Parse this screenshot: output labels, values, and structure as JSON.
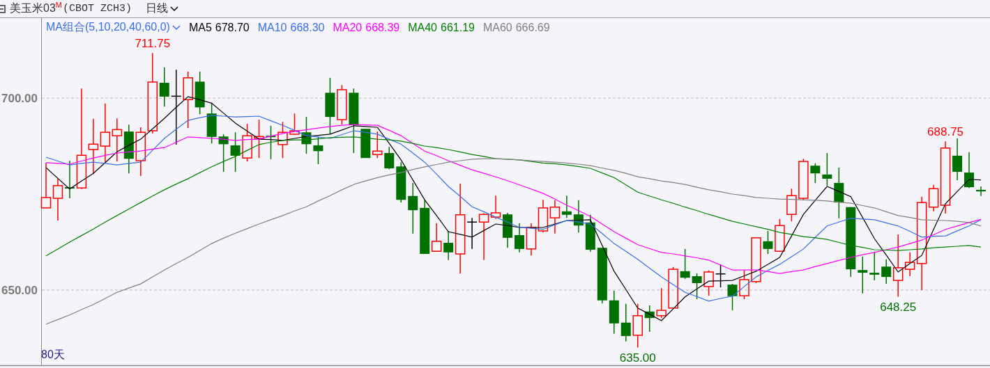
{
  "header": {
    "symbol": "美玉米03$^{M}$",
    "code": "(CBOT ZCH3)",
    "period": "日线"
  },
  "chart": {
    "ma_group": "MA组合(5,10,20,40,60,0)",
    "ma_values": [
      "678.70",
      "668.30",
      "668.39",
      "661.19",
      "666.69"
    ],
    "range_label": "80天",
    "chart_data": {
      "type": "candlestick",
      "ylim": [
        630.4,
        720.5
      ],
      "ohlc": [
        [
          671.4,
          683.1,
          671.4,
          674.1
        ],
        [
          673.9,
          679.0,
          668.1,
          677.2
        ],
        [
          676.8,
          683.7,
          673.9,
          676.6
        ],
        [
          676.6,
          702.5,
          676.3,
          685.1
        ],
        [
          686.6,
          694.6,
          680.2,
          688.0
        ],
        [
          687.5,
          698.6,
          683.3,
          691.1
        ],
        [
          690.2,
          694.7,
          683.5,
          691.8
        ],
        [
          691.3,
          693.1,
          680.4,
          684.2
        ],
        [
          683.7,
          692.4,
          679.7,
          691.1
        ],
        [
          691.5,
          711.75,
          690.8,
          704.2
        ],
        [
          704.0,
          708.0,
          697.8,
          700.4
        ],
        [
          700.5,
          707.4,
          687.9,
          700.5
        ],
        [
          699.6,
          706.9,
          692.2,
          705.3
        ],
        [
          704.3,
          706.9,
          695.8,
          697.6
        ],
        [
          696.0,
          698.7,
          688.2,
          689.9
        ],
        [
          690.0,
          690.6,
          680.8,
          688.0
        ],
        [
          687.7,
          691.1,
          680.8,
          685.0
        ],
        [
          684.4,
          693.3,
          683.5,
          690.2
        ],
        [
          689.5,
          694.4,
          684.4,
          690.0
        ],
        [
          690.2,
          692.8,
          684.1,
          689.9
        ],
        [
          687.9,
          693.8,
          684.4,
          691.1
        ],
        [
          690.6,
          696.0,
          690.6,
          691.5
        ],
        [
          691.1,
          695.1,
          685.5,
          688.0
        ],
        [
          687.7,
          689.9,
          682.8,
          686.2
        ],
        [
          701.4,
          705.3,
          690.6,
          695.1
        ],
        [
          694.4,
          703.4,
          693.1,
          702.2
        ],
        [
          701.4,
          702.5,
          685.7,
          693.1
        ],
        [
          692.0,
          692.0,
          684.4,
          684.4
        ],
        [
          685.3,
          691.3,
          684.4,
          686.2
        ],
        [
          685.7,
          687.3,
          681.5,
          681.7
        ],
        [
          682.2,
          683.3,
          672.8,
          673.5
        ],
        [
          674.5,
          677.9,
          664.7,
          670.8
        ],
        [
          671.4,
          673.5,
          659.4,
          659.4
        ],
        [
          660.1,
          667.4,
          660.0,
          662.7
        ],
        [
          662.3,
          665.4,
          657.8,
          659.8
        ],
        [
          659.4,
          677.7,
          654.3,
          669.6
        ],
        [
          667.7,
          668.8,
          660.7,
          667.7
        ],
        [
          667.7,
          670.0,
          657.8,
          669.7
        ],
        [
          669.0,
          674.6,
          668.5,
          670.1
        ],
        [
          669.7,
          670.1,
          661.0,
          663.6
        ],
        [
          664.3,
          667.4,
          659.8,
          660.7
        ],
        [
          660.7,
          667.4,
          659.0,
          666.3
        ],
        [
          665.4,
          673.5,
          665.0,
          671.4
        ],
        [
          668.8,
          673.4,
          664.7,
          671.6
        ],
        [
          670.5,
          674.6,
          668.8,
          669.6
        ],
        [
          669.7,
          673.4,
          665.0,
          666.8
        ],
        [
          667.6,
          669.6,
          660.0,
          660.5
        ],
        [
          661.0,
          661.0,
          646.5,
          647.3
        ],
        [
          647.3,
          649.8,
          638.6,
          641.3
        ],
        [
          641.5,
          646.4,
          636.6,
          638.0
        ],
        [
          638.2,
          646.4,
          635.0,
          643.3
        ],
        [
          644.4,
          646.0,
          639.1,
          642.7
        ],
        [
          643.3,
          650.5,
          642.7,
          644.7
        ],
        [
          645.3,
          656.0,
          645.3,
          655.4
        ],
        [
          654.9,
          660.7,
          652.9,
          653.2
        ],
        [
          653.6,
          654.3,
          647.6,
          651.8
        ],
        [
          650.9,
          655.1,
          648.5,
          654.7
        ],
        [
          654.2,
          656.7,
          650.7,
          654.2
        ],
        [
          651.4,
          651.6,
          644.7,
          648.4
        ],
        [
          648.5,
          655.1,
          647.6,
          652.7
        ],
        [
          652.2,
          663.6,
          651.8,
          663.6
        ],
        [
          662.7,
          665.4,
          659.4,
          660.7
        ],
        [
          660.1,
          668.5,
          660.0,
          666.8
        ],
        [
          669.7,
          676.4,
          667.9,
          674.6
        ],
        [
          673.9,
          684.2,
          673.4,
          683.5
        ],
        [
          682.4,
          683.0,
          677.9,
          680.4
        ],
        [
          680.1,
          685.7,
          677.2,
          679.0
        ],
        [
          677.9,
          681.9,
          668.7,
          672.8
        ],
        [
          671.6,
          671.6,
          653.4,
          655.4
        ],
        [
          655.2,
          658.7,
          649.1,
          654.5
        ],
        [
          654.5,
          660.0,
          652.5,
          654.0
        ],
        [
          656.1,
          658.0,
          651.6,
          653.4
        ],
        [
          652.5,
          664.5,
          648.25,
          655.8
        ],
        [
          655.4,
          659.8,
          653.6,
          657.2
        ],
        [
          656.9,
          674.3,
          650.0,
          672.8
        ],
        [
          671.6,
          677.4,
          670.5,
          676.4
        ],
        [
          672.1,
          688.75,
          669.9,
          687.0
        ],
        [
          685.0,
          689.5,
          678.6,
          680.8
        ],
        [
          680.6,
          685.9,
          676.6,
          676.8
        ],
        [
          676.1,
          677.0,
          674.5,
          675.7
        ]
      ],
      "annotations": [
        "711.75",
        "635.00",
        "648.25",
        "688.75"
      ]
    },
    "moving_averages": {
      "chart_data": {
        "type": "line",
        "ylim": [
          630.4,
          720.5
        ],
        "yticks": [
          {
            "value": 700,
            "label": "700.00"
          },
          {
            "value": 650,
            "label": "650.00"
          }
        ],
        "series": [
          {
            "name": "MA5",
            "color": "#000000",
            "values": [
              681.9,
              679.1,
              676.3,
              678.4,
              680.4,
              683.2,
              686.0,
              687.7,
              689.3,
              692.0,
              694.7,
              697.6,
              700.4,
              699.6,
              698.7,
              696.1,
              693.5,
              691.4,
              689.3,
              689.2,
              689.0,
              689.5,
              690.0,
              690.3,
              690.6,
              691.7,
              692.8,
              692.6,
              692.4,
              688.2,
              683.9,
              678.7,
              673.5,
              669.4,
              665.2,
              664.5,
              663.8,
              665.5,
              667.2,
              666.8,
              666.3,
              666.3,
              666.3,
              667.2,
              668.1,
              668.2,
              668.3,
              661.6,
              654.9,
              650.1,
              645.3,
              643.7,
              642.0,
              645.1,
              648.2,
              650.3,
              652.3,
              652.4,
              652.5,
              653.7,
              654.9,
              656.7,
              658.5,
              664.1,
              669.7,
              673.4,
              677.0,
              675.7,
              674.3,
              668.9,
              663.4,
              659.1,
              654.7,
              656.9,
              659.0,
              665.8,
              672.5,
              675.7,
              678.8,
              678.7
            ]
          },
          {
            "name": "MA10",
            "color": "#3a6ee8",
            "values": [
              684.6,
              683.6,
              682.6,
              683.0,
              683.3,
              683.0,
              682.6,
              683.0,
              683.3,
              686.4,
              689.5,
              691.9,
              694.2,
              694.9,
              695.5,
              695.3,
              695.1,
              695.2,
              695.3,
              694.1,
              692.9,
              691.6,
              690.2,
              689.9,
              689.5,
              690.5,
              691.5,
              691.1,
              690.6,
              689.3,
              688.0,
              685.7,
              683.3,
              680.2,
              677.0,
              674.4,
              671.7,
              670.4,
              669.0,
              667.7,
              666.3,
              666.1,
              665.8,
              667.0,
              668.1,
              667.7,
              667.2,
              664.7,
              662.1,
              660.1,
              658.0,
              655.7,
              653.4,
              651.4,
              649.4,
              648.3,
              647.1,
              647.8,
              648.4,
              650.9,
              653.4,
              655.1,
              656.7,
              658.7,
              660.7,
              663.7,
              666.7,
              667.7,
              668.7,
              668.5,
              668.3,
              667.5,
              666.7,
              665.3,
              663.8,
              664.0,
              664.1,
              665.4,
              666.7,
              668.3
            ]
          },
          {
            "name": "MA20",
            "color": "#ff00ff",
            "values": [
              683.2,
              683.0,
              682.8,
              683.6,
              684.4,
              685.1,
              685.7,
              686.0,
              686.2,
              686.7,
              687.1,
              688.5,
              689.9,
              689.7,
              689.5,
              689.3,
              689.0,
              689.2,
              689.3,
              690.1,
              690.8,
              691.3,
              691.8,
              692.2,
              692.6,
              692.9,
              693.1,
              693.0,
              692.9,
              691.6,
              690.2,
              688.2,
              686.2,
              685.0,
              683.7,
              682.5,
              681.3,
              680.4,
              679.5,
              678.5,
              677.4,
              676.3,
              675.2,
              673.7,
              672.1,
              670.7,
              669.2,
              667.2,
              665.2,
              663.5,
              661.8,
              660.8,
              659.8,
              659.4,
              658.9,
              658.4,
              657.8,
              656.5,
              655.2,
              655.2,
              655.2,
              654.8,
              654.3,
              654.8,
              655.2,
              656.1,
              656.9,
              657.7,
              658.5,
              659.2,
              659.8,
              660.5,
              661.2,
              662.1,
              663.0,
              664.4,
              665.8,
              666.7,
              667.6,
              668.4
            ]
          },
          {
            "name": "MA40",
            "color": "#008000",
            "values": [
              658.9,
              660.7,
              662.5,
              664.2,
              665.9,
              667.7,
              669.4,
              671.1,
              672.8,
              674.5,
              676.1,
              677.6,
              679.0,
              680.6,
              682.1,
              683.5,
              684.8,
              686.4,
              687.9,
              688.5,
              689.0,
              689.1,
              689.1,
              689.4,
              689.7,
              689.8,
              689.9,
              689.6,
              689.3,
              689.1,
              688.8,
              688.2,
              687.5,
              687.1,
              686.6,
              686.0,
              685.3,
              684.8,
              684.2,
              684.1,
              683.9,
              683.5,
              683.1,
              682.9,
              682.6,
              682.2,
              681.7,
              680.5,
              679.3,
              677.4,
              675.5,
              674.5,
              673.5,
              672.6,
              671.6,
              670.7,
              669.7,
              668.8,
              667.9,
              667.2,
              666.5,
              665.8,
              665.0,
              664.5,
              663.9,
              663.6,
              663.2,
              662.4,
              661.6,
              661.1,
              660.5,
              660.4,
              660.3,
              660.5,
              660.7,
              661.0,
              661.2,
              661.4,
              661.6,
              661.2
            ]
          },
          {
            "name": "MA60",
            "color": "#808080",
            "values": [
              641.1,
              642.3,
              643.5,
              644.9,
              646.2,
              647.8,
              649.4,
              650.5,
              651.6,
              653.4,
              655.2,
              656.9,
              658.5,
              660.3,
              662.1,
              663.5,
              664.8,
              666.0,
              667.2,
              668.3,
              669.4,
              670.6,
              671.7,
              673.2,
              674.6,
              676.1,
              677.5,
              678.4,
              679.3,
              680.0,
              680.6,
              681.4,
              682.1,
              682.7,
              683.3,
              683.7,
              684.1,
              684.2,
              684.2,
              684.1,
              683.9,
              683.7,
              683.5,
              683.3,
              683.1,
              682.8,
              682.4,
              681.8,
              681.2,
              680.4,
              679.5,
              679.0,
              678.4,
              678.0,
              677.5,
              676.8,
              676.1,
              675.6,
              675.0,
              674.6,
              674.1,
              673.9,
              673.7,
              673.6,
              673.5,
              673.4,
              673.2,
              672.9,
              672.6,
              672.0,
              671.4,
              670.4,
              669.4,
              668.9,
              668.3,
              668.2,
              668.1,
              667.9,
              667.6,
              666.7
            ]
          }
        ]
      }
    }
  }
}
